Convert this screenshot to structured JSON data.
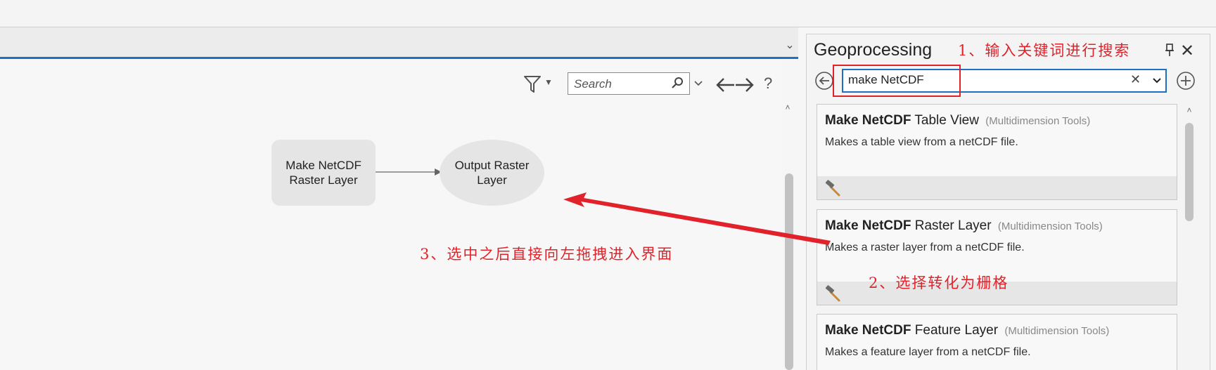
{
  "canvas_toolbar": {
    "search_placeholder": "Search",
    "help": "?"
  },
  "model": {
    "tool_node": [
      "Make NetCDF",
      "Raster Layer"
    ],
    "output_node": [
      "Output Raster",
      "Layer"
    ]
  },
  "annotations": {
    "step1": "1、输入关键词进行搜索",
    "step2": "2、选择转化为栅格",
    "step3": "3、选中之后直接向左拖拽进入界面",
    "color": "#e1222a"
  },
  "geoprocessing": {
    "title": "Geoprocessing",
    "search_value": "make NetCDF",
    "results": [
      {
        "title_bold": "Make NetCDF",
        "title_rest": "Table View",
        "category": "(Multidimension Tools)",
        "description": "Makes a table view from a netCDF file.",
        "icon": "hammer-icon"
      },
      {
        "title_bold": "Make NetCDF",
        "title_rest": "Raster Layer",
        "category": "(Multidimension Tools)",
        "description": "Makes a raster layer from a netCDF file.",
        "icon": "hammer-icon"
      },
      {
        "title_bold": "Make NetCDF",
        "title_rest": "Feature Layer",
        "category": "(Multidimension Tools)",
        "description": "Makes a feature layer from a netCDF file.",
        "icon": "hammer-icon"
      }
    ]
  },
  "colors": {
    "accent": "#1f6fc5",
    "annotation_red": "#e1222a",
    "node_fill": "#e5e5e5"
  }
}
